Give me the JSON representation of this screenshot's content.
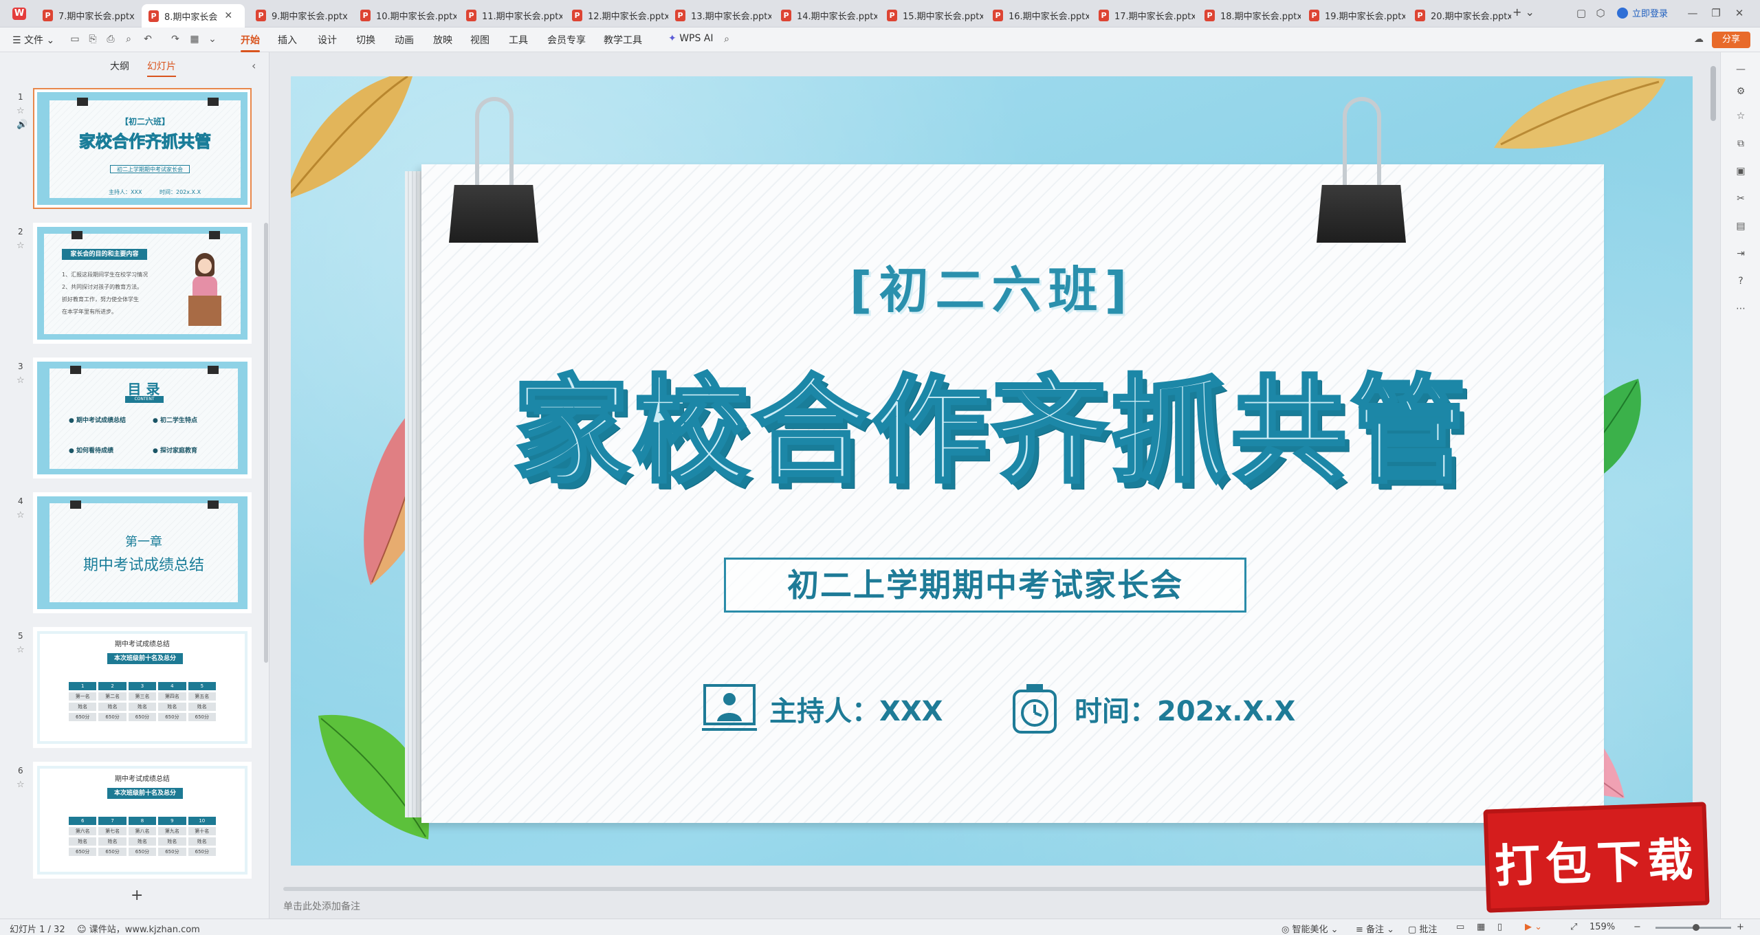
{
  "tabs": [
    {
      "label": "7.期中家长会.pptx",
      "active": false
    },
    {
      "label": "8.期中家长会",
      "active": true
    },
    {
      "label": "9.期中家长会.pptx",
      "active": false
    },
    {
      "label": "10.期中家长会.pptx",
      "active": false
    },
    {
      "label": "11.期中家长会.pptx",
      "active": false
    },
    {
      "label": "12.期中家长会.pptx",
      "active": false
    },
    {
      "label": "13.期中家长会.pptx",
      "active": false
    },
    {
      "label": "14.期中家长会.pptx",
      "active": false
    },
    {
      "label": "15.期中家长会.pptx",
      "active": false
    },
    {
      "label": "16.期中家长会.pptx",
      "active": false
    },
    {
      "label": "17.期中家长会.pptx",
      "active": false
    },
    {
      "label": "18.期中家长会.pptx",
      "active": false
    },
    {
      "label": "19.期中家长会.pptx",
      "active": false
    },
    {
      "label": "20.期中家长会.pptx",
      "active": false
    }
  ],
  "topright": {
    "login": "立即登录",
    "share": "分享"
  },
  "menu": {
    "file": "文件",
    "items": [
      "开始",
      "插入",
      "设计",
      "切换",
      "动画",
      "放映",
      "视图",
      "工具",
      "会员专享",
      "教学工具"
    ],
    "ai": "WPS AI"
  },
  "panel": {
    "tab_outline": "大纲",
    "tab_slides": "幻灯片",
    "add": "+"
  },
  "thumbs": [
    {
      "num": "1",
      "cls": "【初二六班】",
      "title": "家校合作齐抓共管",
      "sub": "初二上学期期中考试家长会",
      "host": "主持人：XXX",
      "time": "时间：202x.X.X"
    },
    {
      "num": "2",
      "banner": "家长会的目的和主要内容",
      "lines": [
        "1、汇报这段期间学生在校学习情况",
        "2、共同探讨对孩子的教育方法。",
        "    抓好教育工作，努力使全体学生",
        "    在本学年里有所进步。"
      ]
    },
    {
      "num": "3",
      "title": "目 录",
      "tag": "CONTENT",
      "items": [
        "期中考试成绩总结",
        "初二学生特点",
        "如何看待成绩",
        "探讨家庭教育"
      ]
    },
    {
      "num": "4",
      "chapter": "第一章",
      "title": "期中考试成绩总结"
    },
    {
      "num": "5",
      "heading": "期中考试成绩总结",
      "banner": "本次班级前十名及总分",
      "head": [
        "1",
        "2",
        "3",
        "4",
        "5"
      ],
      "rank": [
        "第一名",
        "第二名",
        "第三名",
        "第四名",
        "第五名"
      ],
      "name": [
        "姓名",
        "姓名",
        "姓名",
        "姓名",
        "姓名"
      ],
      "score": [
        "650分",
        "650分",
        "650分",
        "650分",
        "650分"
      ]
    },
    {
      "num": "6",
      "heading": "期中考试成绩总结",
      "banner": "本次班级前十名及总分",
      "head": [
        "6",
        "7",
        "8",
        "9",
        "10"
      ],
      "rank": [
        "第六名",
        "第七名",
        "第八名",
        "第九名",
        "第十名"
      ],
      "name": [
        "姓名",
        "姓名",
        "姓名",
        "姓名",
        "姓名"
      ],
      "score": [
        "650分",
        "650分",
        "650分",
        "650分",
        "650分"
      ]
    }
  ],
  "slide": {
    "class_label": "[初二六班]",
    "title": "家校合作齐抓共管",
    "subtitle": "初二上学期期中考试家长会",
    "host": "主持人：XXX",
    "time": "时间：202x.X.X"
  },
  "notes_placeholder": "单击此处添加备注",
  "watermark": "打包下载",
  "status": {
    "slide_count": "幻灯片 1 / 32",
    "source": "课件站，www.kjzhan.com",
    "beautify": "智能美化",
    "notes": "备注",
    "comment": "批注",
    "zoom": "159%"
  },
  "colors": {
    "accent": "#d9541e",
    "teal": "#1e7b97",
    "sky": "#8fd3e8"
  }
}
